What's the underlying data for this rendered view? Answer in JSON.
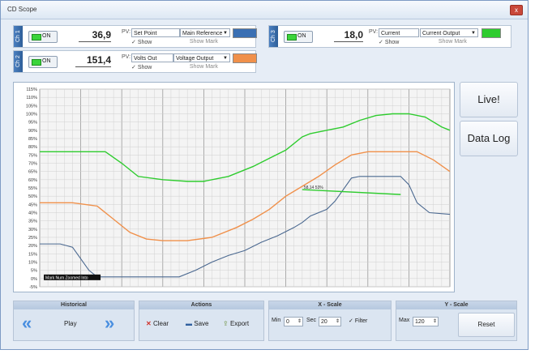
{
  "window": {
    "title": "CD Scope",
    "close_glyph": "x"
  },
  "channels": [
    {
      "tab": "Ch 1",
      "on_label": "ON",
      "value": "36,9",
      "pv_label": "PV:",
      "pv_name": "Set Point",
      "pv_source": "Main Reference",
      "color": "#3a6fb3",
      "show_label": "Show",
      "show_mark_label": "Show Mark"
    },
    {
      "tab": "Ch 2",
      "on_label": "ON",
      "value": "151,4",
      "pv_label": "PV:",
      "pv_name": "Volts Out",
      "pv_source": "Voltage Output",
      "color": "#f0904a",
      "show_label": "Show",
      "show_mark_label": "Show Mark"
    },
    {
      "tab": "Ch 3",
      "on_label": "ON",
      "value": "18,0",
      "pv_label": "PV:",
      "pv_name": "Current",
      "pv_source": "Current Output",
      "color": "#2ecc2e",
      "show_label": "Show",
      "show_mark_label": "Show Mark"
    }
  ],
  "side_buttons": {
    "live": "Live!",
    "data_log": "Data Log"
  },
  "chart_data": {
    "type": "line",
    "y_ticks": [
      "115%",
      "110%",
      "105%",
      "100%",
      "95%",
      "90%",
      "85%",
      "80%",
      "75%",
      "70%",
      "65%",
      "60%",
      "55%",
      "50%",
      "45%",
      "40%",
      "35%",
      "30%",
      "25%",
      "20%",
      "15%",
      "10%",
      "5%",
      "0%",
      "-5%"
    ],
    "ylim": [
      -5,
      115
    ],
    "xlim": [
      0,
      100
    ],
    "grid": true,
    "series": [
      {
        "color": "#2ecc2e",
        "x": [
          0,
          8,
          16,
          20,
          24,
          30,
          36,
          40,
          46,
          52,
          56,
          60,
          64,
          66,
          70,
          74,
          78,
          82,
          86,
          90,
          94,
          98,
          100
        ],
        "y": [
          77,
          77,
          77,
          70,
          62,
          60,
          59,
          59,
          62,
          68,
          73,
          78,
          86,
          88,
          90,
          92,
          96,
          99,
          100,
          100,
          98,
          92,
          90
        ]
      },
      {
        "color": "#f0904a",
        "x": [
          0,
          8,
          14,
          18,
          22,
          26,
          30,
          36,
          42,
          48,
          52,
          56,
          60,
          64,
          68,
          72,
          76,
          80,
          84,
          88,
          92,
          96,
          100
        ],
        "y": [
          46,
          46,
          44,
          36,
          28,
          24,
          23,
          23,
          25,
          31,
          36,
          42,
          50,
          56,
          62,
          69,
          75,
          77,
          77,
          77,
          77,
          72,
          65
        ]
      },
      {
        "color": "#4a6890",
        "x": [
          0,
          5,
          8,
          10,
          12,
          14,
          16,
          22,
          28,
          34,
          38,
          42,
          46,
          50,
          54,
          58,
          62,
          64,
          66,
          70,
          72,
          74,
          76,
          78,
          80,
          82,
          84,
          86,
          88,
          90,
          92,
          95,
          100
        ],
        "y": [
          21,
          21,
          19,
          12,
          5,
          1,
          1,
          1,
          1,
          1,
          5,
          10,
          14,
          17,
          22,
          26,
          31,
          34,
          38,
          42,
          47,
          54,
          61,
          62,
          62,
          62,
          62,
          62,
          62,
          57,
          46,
          40,
          39
        ]
      },
      {
        "color": "#2ecc2e",
        "x": [
          64,
          88
        ],
        "y": [
          54,
          51
        ]
      }
    ],
    "annotations": [
      {
        "text": "58,14 53%",
        "x": 64,
        "y": 54
      },
      {
        "text": "Mark Num Zoomed Into",
        "x": 1,
        "y": -1
      }
    ]
  },
  "bottom": {
    "historical": {
      "header": "Historical",
      "play_label": "Play",
      "prev_glyph": "«",
      "next_glyph": "»"
    },
    "actions": {
      "header": "Actions",
      "clear_label": "Clear",
      "save_label": "Save",
      "export_label": "Export"
    },
    "xscale": {
      "header": "X - Scale",
      "min_label": "Min",
      "min_value": "0",
      "sec_label": "Sec",
      "sec_value": "20",
      "filter_label": "Filter"
    },
    "yscale": {
      "header": "Y - Scale",
      "max_label": "Max",
      "max_value": "120",
      "reset_label": "Reset"
    }
  }
}
